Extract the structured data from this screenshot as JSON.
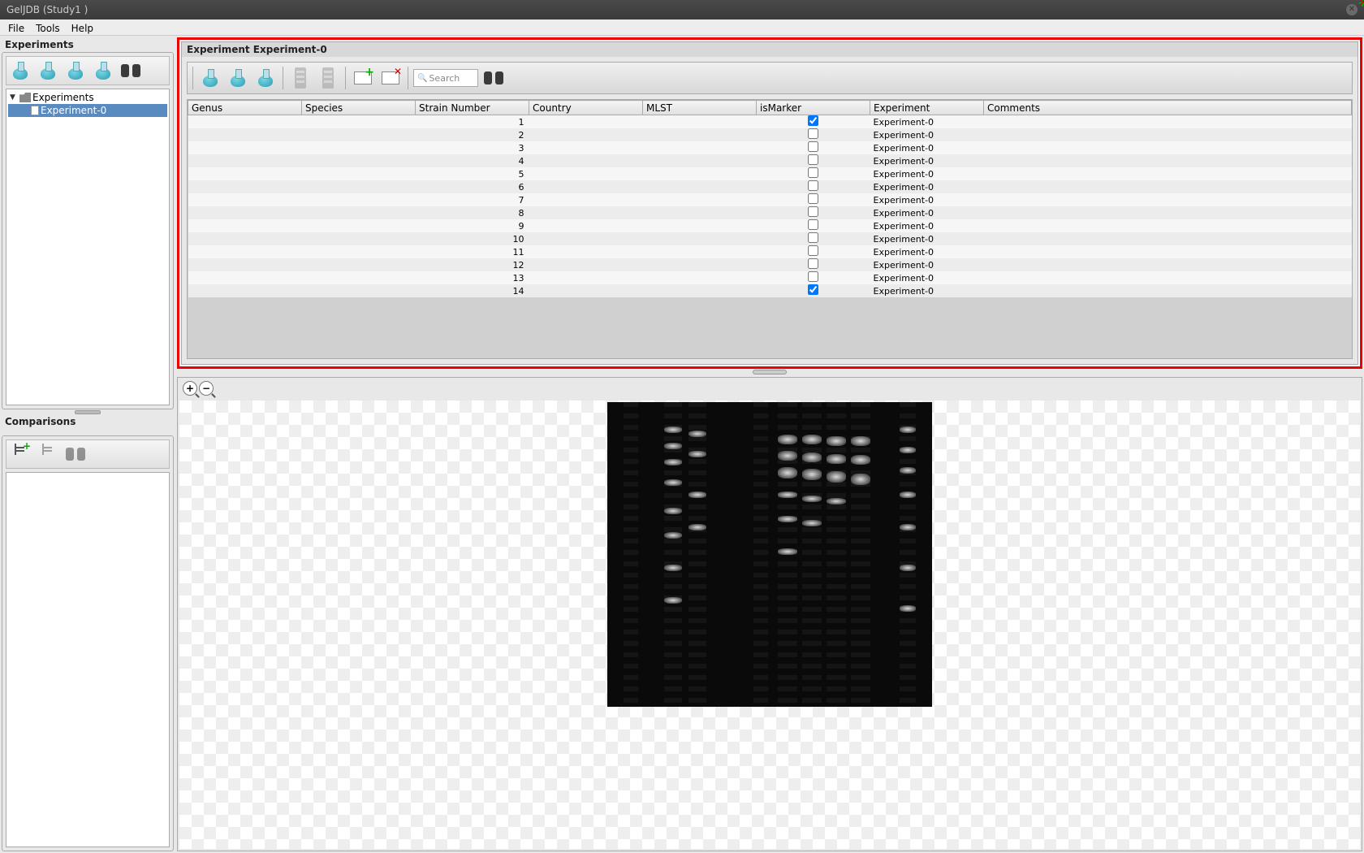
{
  "window": {
    "title": "GelJDB (Study1 )"
  },
  "menu": {
    "file": "File",
    "tools": "Tools",
    "help": "Help"
  },
  "left": {
    "experiments_label": "Experiments",
    "comparisons_label": "Comparisons",
    "tree_root": "Experiments",
    "tree_child": "Experiment-0"
  },
  "pane": {
    "title": "Experiment Experiment-0",
    "search_placeholder": "Search"
  },
  "columns": {
    "genus": "Genus",
    "species": "Species",
    "strain": "Strain Number",
    "country": "Country",
    "mlst": "MLST",
    "marker": "isMarker",
    "experiment": "Experiment",
    "comments": "Comments"
  },
  "rows": [
    {
      "strain": "1",
      "marker": true,
      "exp": "Experiment-0"
    },
    {
      "strain": "2",
      "marker": false,
      "exp": "Experiment-0"
    },
    {
      "strain": "3",
      "marker": false,
      "exp": "Experiment-0"
    },
    {
      "strain": "4",
      "marker": false,
      "exp": "Experiment-0"
    },
    {
      "strain": "5",
      "marker": false,
      "exp": "Experiment-0"
    },
    {
      "strain": "6",
      "marker": false,
      "exp": "Experiment-0"
    },
    {
      "strain": "7",
      "marker": false,
      "exp": "Experiment-0"
    },
    {
      "strain": "8",
      "marker": false,
      "exp": "Experiment-0"
    },
    {
      "strain": "9",
      "marker": false,
      "exp": "Experiment-0"
    },
    {
      "strain": "10",
      "marker": false,
      "exp": "Experiment-0"
    },
    {
      "strain": "11",
      "marker": false,
      "exp": "Experiment-0"
    },
    {
      "strain": "12",
      "marker": false,
      "exp": "Experiment-0"
    },
    {
      "strain": "13",
      "marker": false,
      "exp": "Experiment-0"
    },
    {
      "strain": "14",
      "marker": true,
      "exp": "Experiment-0"
    }
  ]
}
